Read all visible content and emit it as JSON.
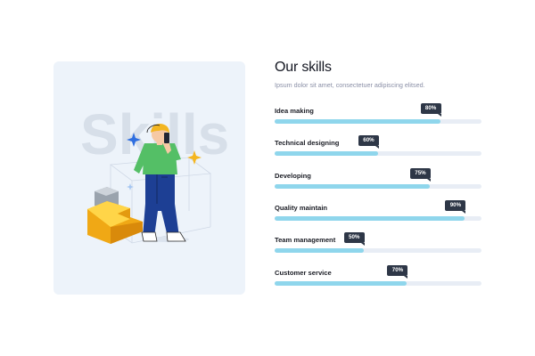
{
  "illustration": {
    "watermark": "Skills"
  },
  "section": {
    "title": "Our skills",
    "subtitle": "Ipsum dolor sit amet, consectetuer adipiscing elitsed."
  },
  "skills": [
    {
      "label": "Idea making",
      "percent": 80,
      "badge": "80%"
    },
    {
      "label": "Technical designing",
      "percent": 50,
      "badge": "60%"
    },
    {
      "label": "Developing",
      "percent": 75,
      "badge": "75%"
    },
    {
      "label": "Quality maintain",
      "percent": 92,
      "badge": "90%"
    },
    {
      "label": "Team management",
      "percent": 43,
      "badge": "50%"
    },
    {
      "label": "Customer service",
      "percent": 64,
      "badge": "70%"
    }
  ],
  "colors": {
    "card_background": "#edf3fa",
    "bar_fill": "#8fd6ec",
    "bar_track": "#e8edf5",
    "badge_background": "#2e3747"
  }
}
